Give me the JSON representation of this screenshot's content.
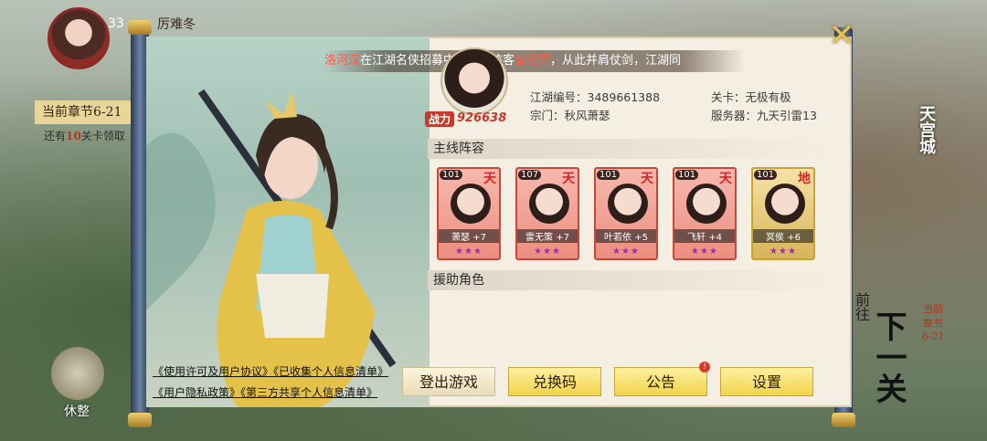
{
  "hud": {
    "level": "33",
    "player_name": "厉难冬",
    "chapter_banner": "当前章节6-21",
    "chapter_sub_prefix": "还有",
    "chapter_sub_count": "10",
    "chapter_sub_suffix": "关卡领取",
    "rest_label": "休整",
    "sky_city": "天宫城",
    "next_stage": "下一关",
    "side_text": "前往",
    "right_chapter": "当前章节6-21"
  },
  "ticker": {
    "name1": "洛河汉",
    "text1": "在江湖名侠招募中获得了侠客",
    "name2": "雷无策",
    "text2": "，从此并肩仗剑，江湖同"
  },
  "profile": {
    "power_badge": "战力",
    "power_value": "926638",
    "id_label": "江湖编号：",
    "id_value": "3489661388",
    "sect_label": "宗门：",
    "sect_value": "秋风萧瑟",
    "stage_label": "关卡：",
    "stage_value": "无极有极",
    "server_label": "服务器：",
    "server_value": "九天引雷13"
  },
  "sections": {
    "main_lineup": "主线阵容",
    "support_role": "援助角色"
  },
  "heroes": [
    {
      "level": "101",
      "grade": "天",
      "name": "萧瑟",
      "plus": "+7",
      "stars": "★★★"
    },
    {
      "level": "107",
      "grade": "天",
      "name": "雷无策",
      "plus": "+7",
      "stars": "★★★"
    },
    {
      "level": "101",
      "grade": "天",
      "name": "叶若依",
      "plus": "+5",
      "stars": "★★★"
    },
    {
      "level": "101",
      "grade": "天",
      "name": "飞轩",
      "plus": "+4",
      "stars": "★★★"
    },
    {
      "level": "101",
      "grade": "地",
      "name": "冥侯",
      "plus": "+6",
      "stars": "★★★"
    }
  ],
  "links": {
    "license": "《使用许可及用户协议》",
    "collected": "《已收集个人信息清单》",
    "privacy": "《用户隐私政策》",
    "third_party": "《第三方共享个人信息清单》"
  },
  "buttons": {
    "logout": "登出游戏",
    "redeem": "兑换码",
    "notice": "公告",
    "settings": "设置",
    "notice_badge": "!"
  },
  "colors": {
    "accent_red": "#c23a2b",
    "button_gold": "#f1d34a"
  }
}
